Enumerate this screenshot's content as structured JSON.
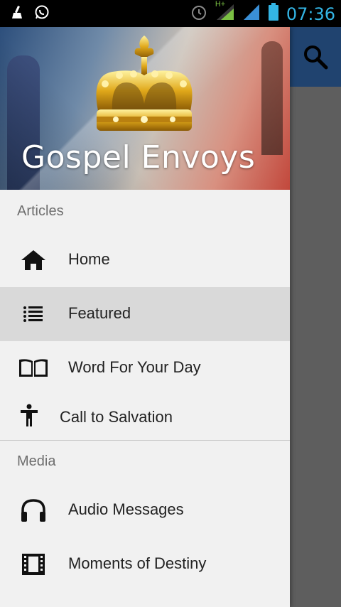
{
  "status_bar": {
    "time": "07:36",
    "network_type": "H+",
    "left_icons": [
      "cleaner-icon",
      "whatsapp-icon"
    ],
    "right_icons": [
      "alarm-icon",
      "signal-icon",
      "signal-icon",
      "battery-icon"
    ]
  },
  "colors": {
    "drawer_bg": "#f1f1f1",
    "active_item_bg": "#d9d9d9",
    "app_bar": "#20436f",
    "clock": "#33b5e5",
    "scrim": "#5e5e5e"
  },
  "header": {
    "title": "Gospel Envoys",
    "image": "crown-icon"
  },
  "search": {
    "icon": "search-icon"
  },
  "sections": [
    {
      "label": "Articles",
      "items": [
        {
          "label": "Home",
          "icon": "home-icon",
          "active": false
        },
        {
          "label": "Featured",
          "icon": "list-icon",
          "active": true
        },
        {
          "label": "Word For Your Day",
          "icon": "book-icon",
          "active": false
        },
        {
          "label": "Call to Salvation",
          "icon": "person-icon",
          "active": false
        }
      ]
    },
    {
      "label": "Media",
      "items": [
        {
          "label": "Audio Messages",
          "icon": "headphones-icon",
          "active": false
        },
        {
          "label": "Moments of Destiny",
          "icon": "film-icon",
          "active": false
        }
      ]
    }
  ]
}
